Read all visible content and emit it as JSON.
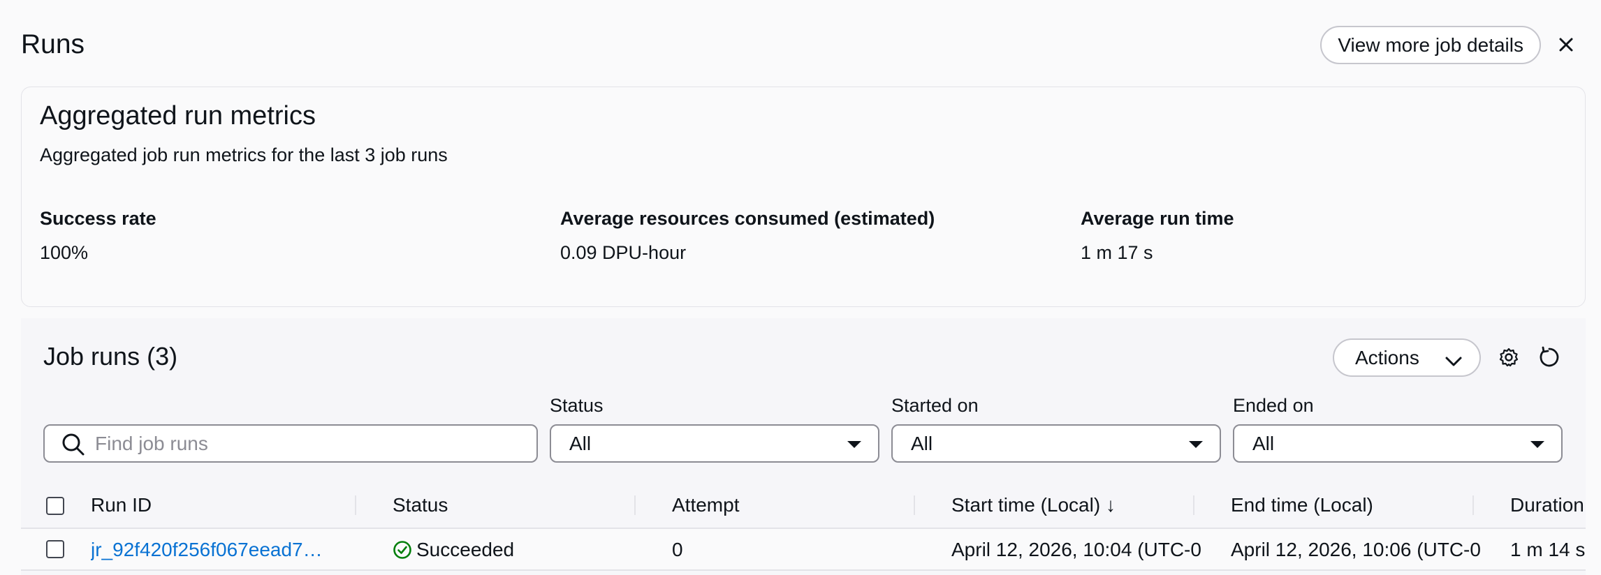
{
  "header": {
    "title": "Runs",
    "view_details_label": "View more job details",
    "close_icon": "×"
  },
  "metrics": {
    "title": "Aggregated run metrics",
    "description": "Aggregated job run metrics for the last 3 job runs",
    "items": [
      {
        "label": "Success rate",
        "value": "100%"
      },
      {
        "label": "Average resources consumed (estimated)",
        "value": "0.09 DPU-hour"
      },
      {
        "label": "Average run time",
        "value": "1 m 17 s"
      }
    ]
  },
  "job_runs": {
    "title": "Job runs (3)",
    "actions_label": "Actions",
    "search_placeholder": "Find job runs",
    "filters": [
      {
        "label": "Status",
        "value": "All"
      },
      {
        "label": "Started on",
        "value": "All"
      },
      {
        "label": "Ended on",
        "value": "All"
      }
    ],
    "columns": [
      "Run ID",
      "Status",
      "Attempt",
      "Start time (Local)",
      "End time (Local)",
      "Duration"
    ],
    "sort_icon": "↓",
    "rows": [
      {
        "run_id": "jr_92f420f256f067eead7…",
        "status": "Succeeded",
        "attempt": "0",
        "start_time": "April 12, 2026, 10:04 (UTC-0",
        "end_time": "April 12, 2026, 10:06 (UTC-0",
        "duration": "1 m 14 s"
      }
    ]
  },
  "colors": {
    "link": "#0972d3",
    "success": "#037f0c",
    "text": "#0f141a",
    "border": "#c6c6cd"
  }
}
